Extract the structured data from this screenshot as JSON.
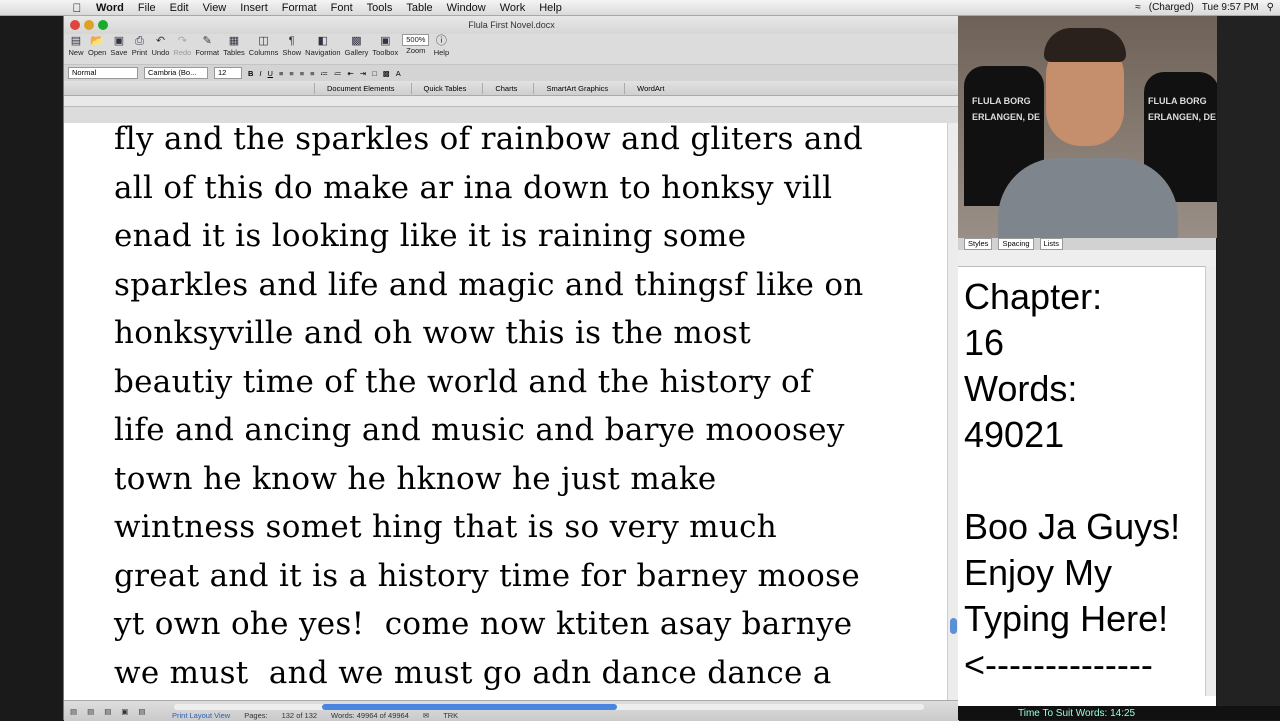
{
  "menubar": {
    "app_name": "Word",
    "items": [
      "File",
      "Edit",
      "View",
      "Insert",
      "Format",
      "Font",
      "Tools",
      "Table",
      "Window",
      "Work",
      "Help"
    ],
    "status": "(Charged)",
    "clock": "Tue 9:57 PM"
  },
  "window": {
    "title": "Flula First Novel.docx"
  },
  "toolbar": {
    "buttons": [
      "New",
      "Open",
      "Save",
      "Print",
      "Undo",
      "Redo",
      "Format",
      "Tables",
      "Columns",
      "Show",
      "Navigation",
      "Gallery",
      "Toolbox",
      "Zoom",
      "Help"
    ],
    "zoom": "500%"
  },
  "format": {
    "style": "Normal",
    "font": "Cambria (Bo...",
    "size": "12"
  },
  "ribbon": {
    "tabs": [
      "Document Elements",
      "Quick Tables",
      "Charts",
      "SmartArt Graphics",
      "WordArt"
    ]
  },
  "document": {
    "lines": [
      "fly and the sparkles of rainbow and gliters and",
      "all of this do make ar ina down to honksy vill",
      "enad it is looking like it is raining some",
      "sparkles and life and magic and thingsf like on",
      "honksyville and oh wow this is the most",
      "beautiy time of the world and the history of",
      "life and ancing and music and barye mooosey",
      "town he know he hknow he just make",
      "wintness somet hing that is so very much",
      "great and it is a history time for barney moose",
      "yt own ohe yes!  come now ktiten asay barnye",
      "we must  and we must go adn dance dance a"
    ]
  },
  "status": {
    "view": "Print Layout View",
    "pages_label": "Pages:",
    "pages": "132 of 132",
    "words": "Words: 49964 of 49964",
    "trk": "TRK"
  },
  "webcam": {
    "shirt_text_1": "FLULA BORG",
    "shirt_text_2": "ERLANGEN, DE"
  },
  "side": {
    "bar": [
      "Styles",
      "Spacing",
      "Lists"
    ],
    "lines": [
      "Chapter:",
      "16",
      "Words:",
      "49021",
      "",
      "Boo Ja Guys!",
      "Enjoy My",
      "Typing Here!",
      "<--------------"
    ]
  },
  "bottom": {
    "text": "Time To Suit Words: 14:25"
  }
}
